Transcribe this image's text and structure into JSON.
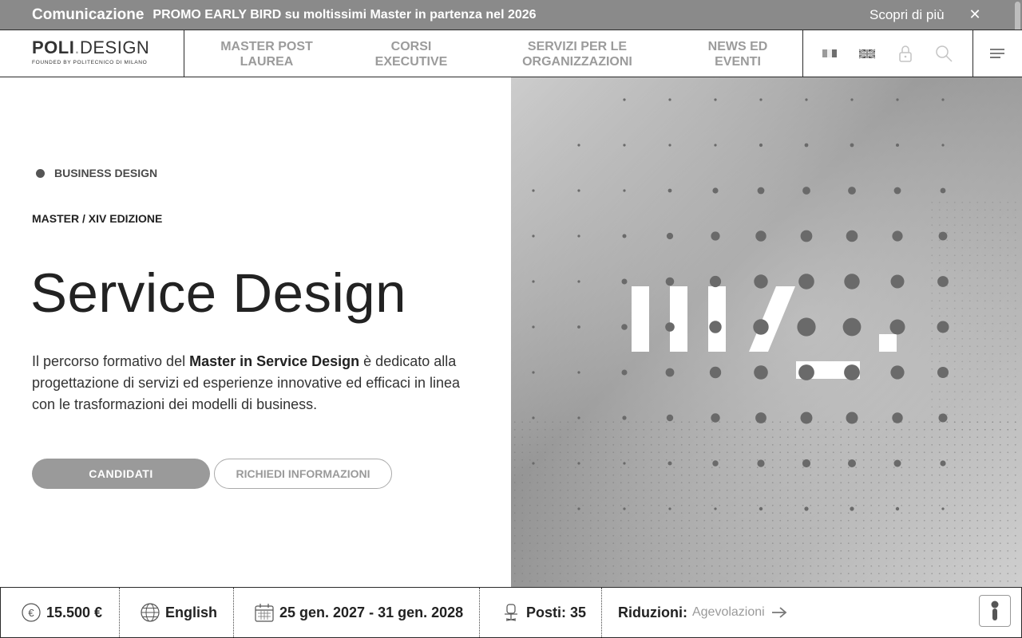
{
  "announcement": {
    "label": "Comunicazione",
    "promo_text": "PROMO EARLY BIRD su moltissimi Master in partenza nel 2026",
    "more_link": "Scopri di più",
    "close_glyph": "✕"
  },
  "header": {
    "logo_main_bold": "POLI",
    "logo_dot": ".",
    "logo_main_rest": "DESIGN",
    "logo_sub": "FOUNDED BY POLITECNICO DI MILANO",
    "nav": [
      {
        "line1": "MASTER POST",
        "line2": "LAUREA"
      },
      {
        "line1": "CORSI",
        "line2": "EXECUTIVE"
      },
      {
        "line1": "SERVIZI PER LE",
        "line2": "ORGANIZZAZIONI"
      },
      {
        "line1": "NEWS ED",
        "line2": "EVENTI"
      }
    ],
    "icons": [
      "italy-flag-icon",
      "uk-flag-icon",
      "lock-icon",
      "search-icon",
      "hamburger-menu-icon"
    ]
  },
  "hero": {
    "category": "BUSINESS DESIGN",
    "edition": "MASTER / XIV EDIZIONE",
    "title": "Service Design",
    "desc_pre": "Il percorso formativo del ",
    "desc_bold": "Master in Service Design",
    "desc_post": " è dedicato alla progettazione di servizi ed esperienze innovative ed efficaci in linea con le trasformazioni dei modelli di business.",
    "btn_apply": "CANDIDATI",
    "btn_info": "RICHIEDI INFORMAZIONI"
  },
  "infobar": {
    "price": "15.500 €",
    "language": "English",
    "dates": "25 gen. 2027 - 31 gen. 2028",
    "seats": "Posti: 35",
    "reductions_label": "Riduzioni:",
    "reductions_link": "Agevolazioni",
    "icons": [
      "euro-icon",
      "globe-icon",
      "calendar-icon",
      "seat-icon",
      "arrow-right-icon",
      "accessibility-icon"
    ]
  },
  "colors": {
    "announce_bg": "#8a8a8a",
    "button_primary": "#9a9a9a",
    "text_dark": "#222222"
  }
}
